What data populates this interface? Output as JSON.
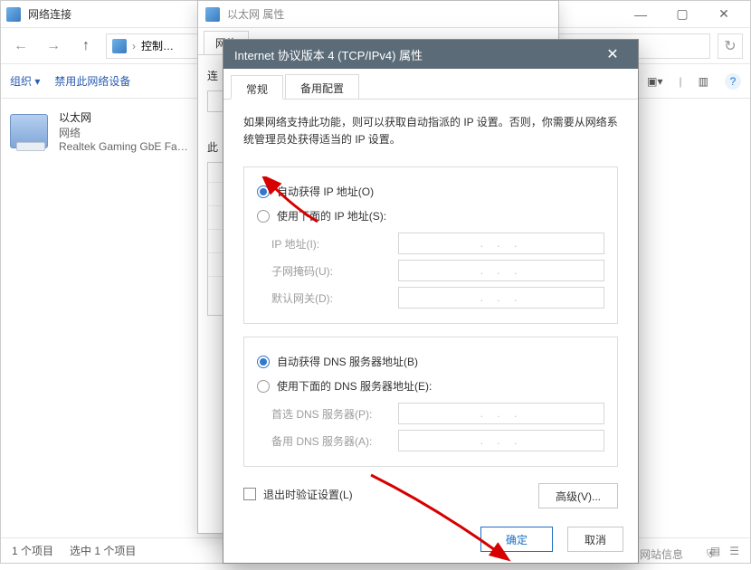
{
  "explorer": {
    "title": "网络连接",
    "nav_back_icon": "←",
    "nav_fwd_icon": "→",
    "nav_up_icon": "↑",
    "refresh_icon": "↻",
    "breadcrumb_sep": "›",
    "breadcrumb1": "控制…",
    "toolbar": {
      "organize": "组织 ▾",
      "disable": "禁用此网络设备",
      "view_icon": "▣▾",
      "details_icon": "▥",
      "help_icon": "?"
    },
    "item": {
      "name": "以太网",
      "line2": "网络",
      "line3": "Realtek Gaming GbE Fa…"
    },
    "status": {
      "count": "1 个项目",
      "selected": "选中 1 个项目"
    }
  },
  "ethDialog": {
    "title": "以太网 属性",
    "tab_network": "网络",
    "connect_label": "连",
    "this_label": "此"
  },
  "ipv4": {
    "title": "Internet 协议版本 4 (TCP/IPv4) 属性",
    "close_icon": "✕",
    "tabs": {
      "general": "常规",
      "alt": "备用配置"
    },
    "desc": "如果网络支持此功能，则可以获取自动指派的 IP 设置。否则，你需要从网络系统管理员处获得适当的 IP 设置。",
    "auto_ip": "自动获得 IP 地址(O)",
    "manual_ip": "使用下面的 IP 地址(S):",
    "ip_label": "IP 地址(I):",
    "mask_label": "子网掩码(U):",
    "gw_label": "默认网关(D):",
    "auto_dns": "自动获得 DNS 服务器地址(B)",
    "manual_dns": "使用下面的 DNS 服务器地址(E):",
    "dns1_label": "首选 DNS 服务器(P):",
    "dns2_label": "备用 DNS 服务器(A):",
    "validate": "退出时验证设置(L)",
    "advanced": "高级(V)...",
    "ok": "确定",
    "cancel": "取消",
    "ip_dots": ".    .    ."
  },
  "bottom_strip": {
    "site_info": "网站信息"
  }
}
